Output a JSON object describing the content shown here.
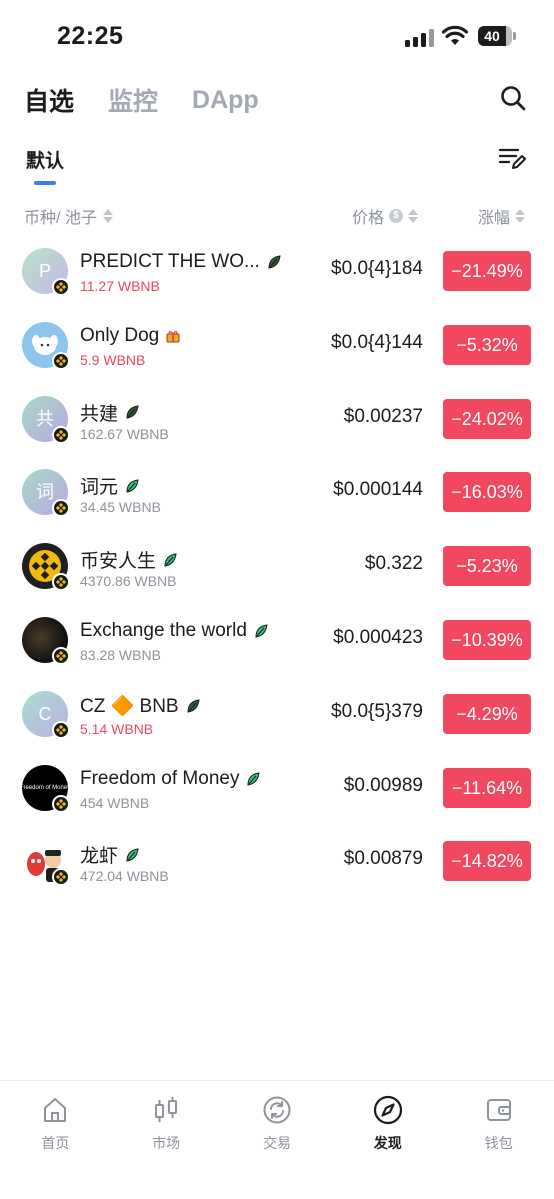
{
  "status_bar": {
    "time": "22:25",
    "battery": "40"
  },
  "top_tabs": [
    {
      "label": "自选",
      "active": true
    },
    {
      "label": "监控",
      "active": false
    },
    {
      "label": "DApp",
      "active": false
    }
  ],
  "sub_tab": {
    "label": "默认"
  },
  "columns": {
    "coin": "币种/ 池子",
    "price": "价格",
    "price_unit_symbol": "$",
    "change": "涨幅"
  },
  "tokens": [
    {
      "name": "PREDICT THE WO...",
      "pool": "11.27 WBNB",
      "pool_red": true,
      "price": "$0.0{4}184",
      "change": "−21.49%",
      "avatar_letter": "P",
      "avatar_style": "grad-a",
      "tag_icon": "leaf-dark-icon"
    },
    {
      "name": "Only Dog",
      "pool": "5.9 WBNB",
      "pool_red": true,
      "price": "$0.0{4}144",
      "change": "−5.32%",
      "avatar_letter": "",
      "avatar_style": "onlydog",
      "tag_icon": "gift-icon"
    },
    {
      "name": "共建",
      "pool": "162.67 WBNB",
      "pool_red": false,
      "price": "$0.00237",
      "change": "−24.02%",
      "avatar_letter": "共",
      "avatar_style": "grad-b",
      "tag_icon": "leaf-dark-icon"
    },
    {
      "name": "词元",
      "pool": "34.45 WBNB",
      "pool_red": false,
      "price": "$0.000144",
      "change": "−16.03%",
      "avatar_letter": "词",
      "avatar_style": "grad-b",
      "tag_icon": "leaf-icon"
    },
    {
      "name": "币安人生",
      "pool": "4370.86 WBNB",
      "pool_red": false,
      "price": "$0.322",
      "change": "−5.23%",
      "avatar_letter": "",
      "avatar_style": "binance",
      "tag_icon": "leaf-icon"
    },
    {
      "name": "Exchange the world",
      "pool": "83.28 WBNB",
      "pool_red": false,
      "price": "$0.000423",
      "change": "−10.39%",
      "avatar_letter": "",
      "avatar_style": "dark-photo",
      "tag_icon": "leaf-icon"
    },
    {
      "name": "CZ 🔶 BNB",
      "pool": "5.14 WBNB",
      "pool_red": true,
      "price": "$0.0{5}379",
      "change": "−4.29%",
      "avatar_letter": "C",
      "avatar_style": "grad-c",
      "tag_icon": "leaf-dark-icon"
    },
    {
      "name": "Freedom of Money",
      "pool": "454 WBNB",
      "pool_red": false,
      "price": "$0.00989",
      "change": "−11.64%",
      "avatar_letter": "",
      "avatar_style": "freedom",
      "avatar_text": "Freedom of Money",
      "tag_icon": "leaf-icon"
    },
    {
      "name": "龙虾",
      "pool": "472.04 WBNB",
      "pool_red": false,
      "price": "$0.00879",
      "change": "−14.82%",
      "avatar_letter": "",
      "avatar_style": "lobster",
      "tag_icon": "leaf-icon"
    }
  ],
  "bottom_nav": [
    {
      "label": "首页",
      "icon": "home-icon",
      "active": false
    },
    {
      "label": "市场",
      "icon": "candlestick-icon",
      "active": false
    },
    {
      "label": "交易",
      "icon": "swap-icon",
      "active": false
    },
    {
      "label": "发现",
      "icon": "compass-icon",
      "active": true
    },
    {
      "label": "钱包",
      "icon": "wallet-icon",
      "active": false
    }
  ],
  "colors": {
    "negative": "#f1475f",
    "accent": "#3c7ef2",
    "muted": "#8e939c"
  }
}
